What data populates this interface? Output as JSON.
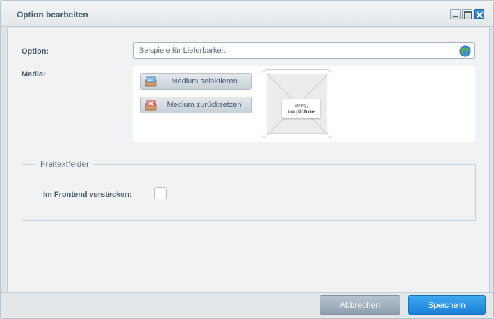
{
  "window": {
    "title": "Option bearbeiten",
    "controls": {
      "minimize_icon": "minimize-icon",
      "maximize_icon": "maximize-icon",
      "close_icon": "close-icon"
    }
  },
  "form": {
    "option_label": "Option:",
    "option_value": "Beispiele für Lieferbarkeit",
    "option_icon": "globe-icon",
    "media_label": "Media:",
    "select_media_label": "Medium selektieren",
    "reset_media_label": "Medium zurücksetzen",
    "preview": {
      "line1": "sorry,",
      "line2": "no picture"
    }
  },
  "freetext": {
    "legend": "Freitextfelder",
    "hide_frontend_label": "Im Frontend verstecken:",
    "hide_frontend_checked": false
  },
  "footer": {
    "cancel_label": "Abbrechen",
    "save_label": "Speichern"
  },
  "colors": {
    "accent": "#1a80d8",
    "cancel": "#8d9ead",
    "text": "#475c6a"
  }
}
